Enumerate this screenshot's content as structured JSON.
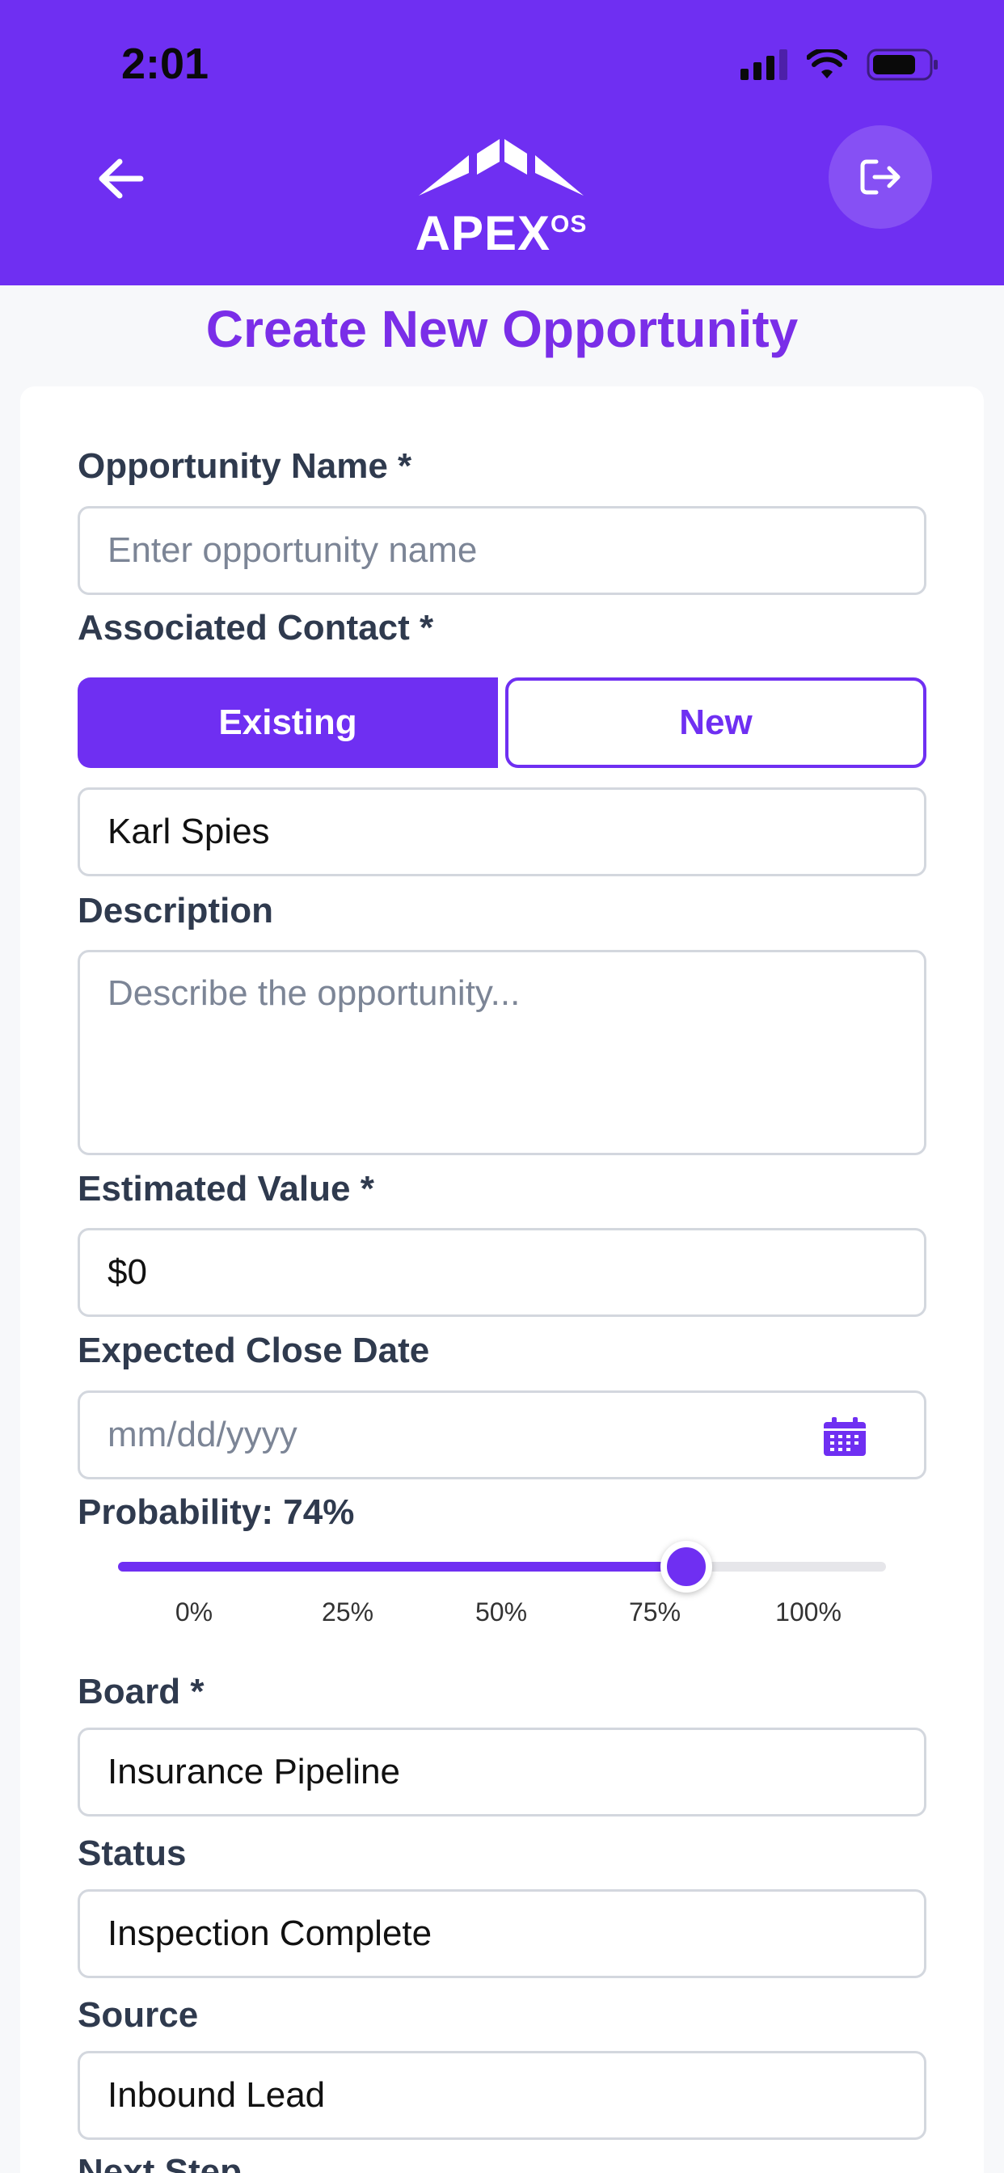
{
  "status_bar": {
    "time": "2:01"
  },
  "header": {
    "logo_text": "APEX",
    "logo_sup": "OS",
    "colors": {
      "brand": "#6f2ff2"
    }
  },
  "page": {
    "title": "Create New Opportunity"
  },
  "form": {
    "opportunity_name": {
      "label": "Opportunity Name *",
      "placeholder": "Enter opportunity name"
    },
    "associated_contact": {
      "label": "Associated Contact *",
      "tabs": [
        "Existing",
        "New"
      ],
      "selected_tab": "Existing",
      "value": "Karl Spies"
    },
    "description": {
      "label": "Description",
      "placeholder": "Describe the opportunity..."
    },
    "estimated_value": {
      "label": "Estimated Value *",
      "value": "$0"
    },
    "expected_close_date": {
      "label": "Expected Close Date",
      "placeholder": "mm/dd/yyyy"
    },
    "probability": {
      "label": "Probability: 74%",
      "value": 74,
      "ticks": [
        "0%",
        "25%",
        "50%",
        "75%",
        "100%"
      ]
    },
    "board": {
      "label": "Board *",
      "value": "Insurance Pipeline"
    },
    "status": {
      "label": "Status",
      "value": "Inspection Complete"
    },
    "source": {
      "label": "Source",
      "value": "Inbound Lead"
    },
    "next_step": {
      "label": "Next Step"
    }
  }
}
